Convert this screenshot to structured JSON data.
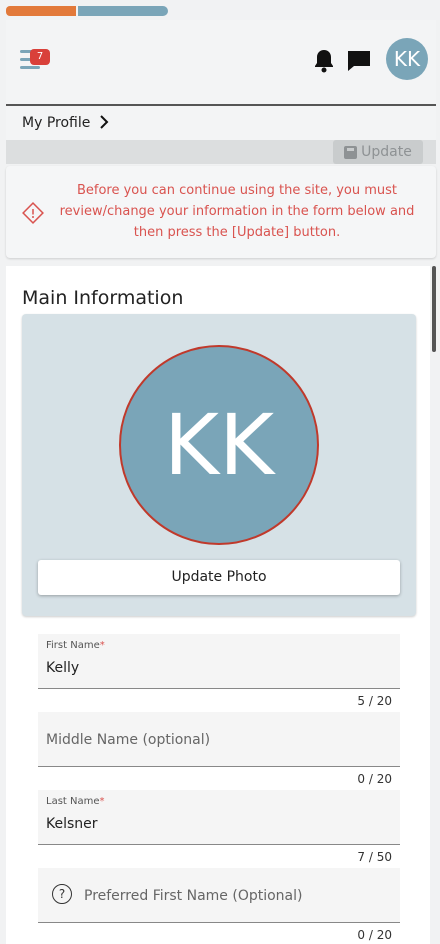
{
  "header": {
    "menu_badge": "7",
    "avatar_initials": "KK",
    "accent": "#7aa5b8",
    "progress_colors": [
      "#e2793a",
      "#7aa5b8"
    ]
  },
  "breadcrumb": {
    "current": "My Profile"
  },
  "toolbar": {
    "update_label": "Update"
  },
  "alert": {
    "message": "Before you can continue using the site, you must review/change your information in the form below and then press the [Update] button.",
    "color": "#d9534f"
  },
  "main": {
    "section_title": "Main Information",
    "photo": {
      "initials": "KK",
      "button_label": "Update Photo"
    },
    "fields": [
      {
        "label": "First Name",
        "required": "*",
        "value": "Kelly",
        "counter": "5 / 20"
      },
      {
        "placeholder": "Middle Name (optional)",
        "counter": "0 / 20"
      },
      {
        "label": "Last Name",
        "required": "*",
        "value": "Kelsner",
        "counter": "7 / 50"
      },
      {
        "placeholder": "Preferred First Name (Optional)",
        "counter": "0 / 20",
        "icon": "help-circle-icon"
      }
    ]
  }
}
